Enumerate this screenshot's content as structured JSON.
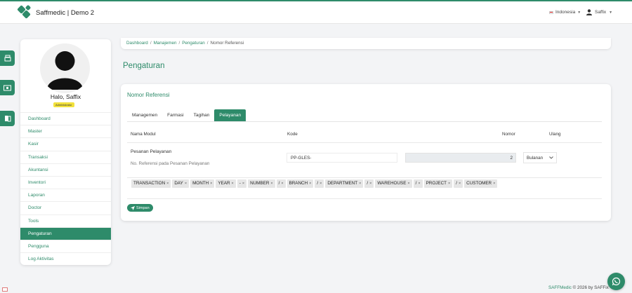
{
  "app": {
    "title": "Saffmedic | Demo 2",
    "language": "Indonesia",
    "user": "Saffix"
  },
  "profile": {
    "greeting": "Halo, Saffix",
    "role": "Administrator"
  },
  "sidebar": {
    "items": [
      {
        "label": "Dashboard"
      },
      {
        "label": "Master"
      },
      {
        "label": "Kasir"
      },
      {
        "label": "Transaksi"
      },
      {
        "label": "Akuntansi"
      },
      {
        "label": "Inventori"
      },
      {
        "label": "Laporan"
      },
      {
        "label": "Doctor"
      },
      {
        "label": "Tools"
      },
      {
        "label": "Pengaturan",
        "active": true
      },
      {
        "label": "Pengguna"
      },
      {
        "label": "Log Aktivitas"
      }
    ]
  },
  "breadcrumb": {
    "items": [
      "Dashboard",
      "Manajemen",
      "Pengaturan"
    ],
    "current": "Nomor Referensi"
  },
  "page": {
    "title": "Pengaturan"
  },
  "card": {
    "title": "Nomor Referensi",
    "tabs": [
      {
        "label": "Managemen"
      },
      {
        "label": "Farmasi"
      },
      {
        "label": "Tagihan"
      },
      {
        "label": "Pelayanan",
        "active": true
      }
    ],
    "headers": {
      "module": "Nama Modul",
      "code": "Kode",
      "number": "Nomor",
      "repeat": "Ulang"
    },
    "row": {
      "module_name": "Pesanan Pelayanan",
      "module_desc": "No. Referensi pada Pesanan Pelayanan",
      "code_value": "PP-GLES-",
      "number_value": "2",
      "repeat_value": "Bulanan"
    },
    "tokens": [
      "TRANSACTION",
      "DAY",
      "MONTH",
      "YEAR",
      "-",
      "NUMBER",
      "/",
      "BRANCH",
      "/",
      "DEPARTMENT",
      "/",
      "WAREHOUSE",
      "/",
      "PROJECT",
      "/",
      "CUSTOMER"
    ],
    "save_label": "Simpan"
  },
  "footer": {
    "brand": "SAFFMedic",
    "text": "© 2026 by SAFFix"
  },
  "colors": {
    "primary": "#2e8b6a",
    "badge": "#f2e13c"
  }
}
